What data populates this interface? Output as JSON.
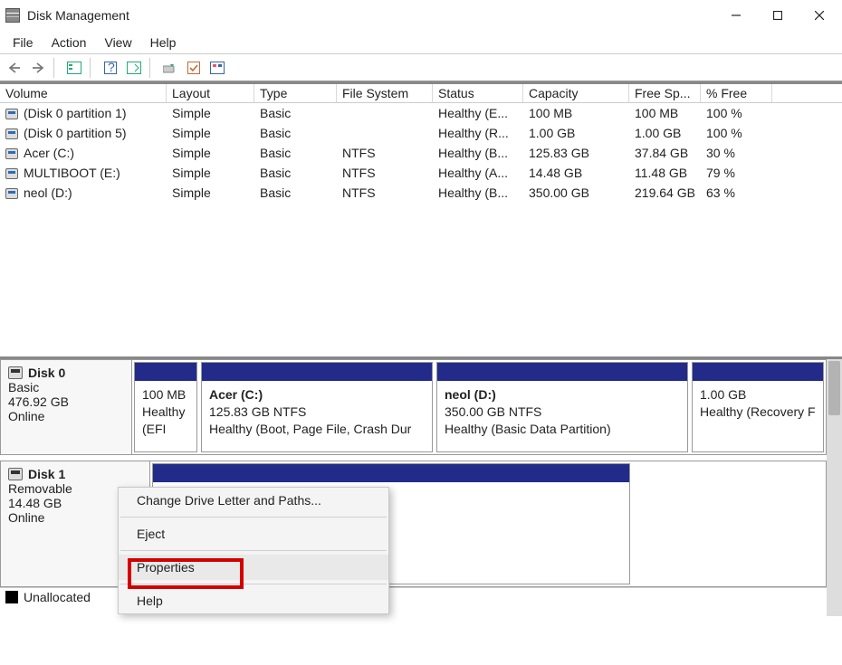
{
  "window": {
    "title": "Disk Management"
  },
  "menubar": {
    "file": "File",
    "action": "Action",
    "view": "View",
    "help": "Help"
  },
  "columns": {
    "volume": "Volume",
    "layout": "Layout",
    "type": "Type",
    "filesystem": "File System",
    "status": "Status",
    "capacity": "Capacity",
    "freespace": "Free Sp...",
    "percentfree": "% Free"
  },
  "volumes": [
    {
      "name": "(Disk 0 partition 1)",
      "layout": "Simple",
      "type": "Basic",
      "fs": "",
      "status": "Healthy (E...",
      "capacity": "100 MB",
      "free": "100 MB",
      "pct": "100 %"
    },
    {
      "name": "(Disk 0 partition 5)",
      "layout": "Simple",
      "type": "Basic",
      "fs": "",
      "status": "Healthy (R...",
      "capacity": "1.00 GB",
      "free": "1.00 GB",
      "pct": "100 %"
    },
    {
      "name": "Acer (C:)",
      "layout": "Simple",
      "type": "Basic",
      "fs": "NTFS",
      "status": "Healthy (B...",
      "capacity": "125.83 GB",
      "free": "37.84 GB",
      "pct": "30 %"
    },
    {
      "name": "MULTIBOOT (E:)",
      "layout": "Simple",
      "type": "Basic",
      "fs": "NTFS",
      "status": "Healthy (A...",
      "capacity": "14.48 GB",
      "free": "11.48 GB",
      "pct": "79 %"
    },
    {
      "name": "neol (D:)",
      "layout": "Simple",
      "type": "Basic",
      "fs": "NTFS",
      "status": "Healthy (B...",
      "capacity": "350.00 GB",
      "free": "219.64 GB",
      "pct": "63 %"
    }
  ],
  "disks": [
    {
      "name": "Disk 0",
      "type": "Basic",
      "size": "476.92 GB",
      "status": "Online",
      "parts": [
        {
          "name": "",
          "line1": "100 MB",
          "line2": "Healthy (EFI"
        },
        {
          "name": "Acer  (C:)",
          "line1": "125.83 GB NTFS",
          "line2": "Healthy (Boot, Page File, Crash Dur"
        },
        {
          "name": "neol  (D:)",
          "line1": "350.00 GB NTFS",
          "line2": "Healthy (Basic Data Partition)"
        },
        {
          "name": "",
          "line1": "1.00 GB",
          "line2": "Healthy (Recovery F"
        }
      ]
    },
    {
      "name": "Disk 1",
      "type": "Removable",
      "size": "14.48 GB",
      "status": "Online",
      "parts": [
        {
          "name": "",
          "line1": "",
          "line2": ""
        }
      ]
    }
  ],
  "legend": {
    "unallocated": "Unallocated"
  },
  "context_menu": {
    "change": "Change Drive Letter and Paths...",
    "eject": "Eject",
    "properties": "Properties",
    "help": "Help"
  }
}
